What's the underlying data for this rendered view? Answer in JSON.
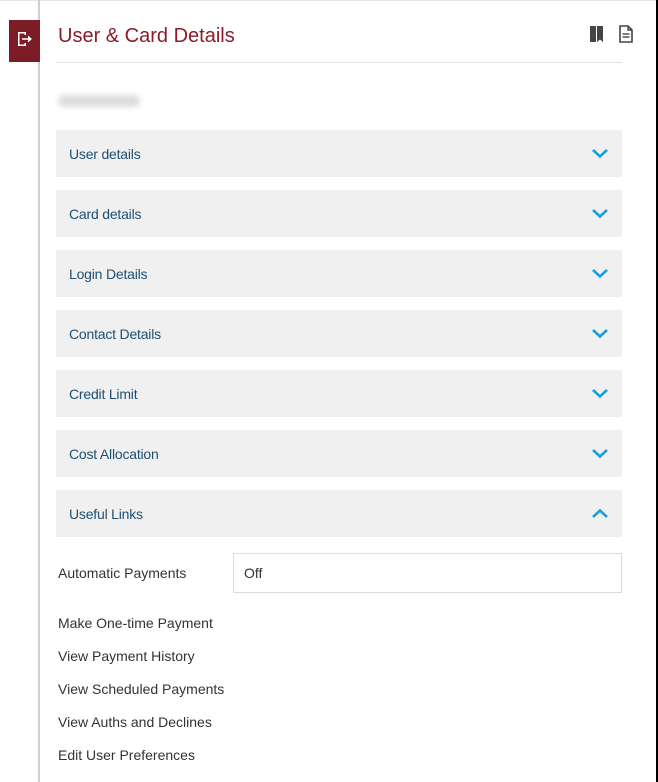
{
  "header": {
    "title": "User & Card Details",
    "exit_icon": "exit-icon",
    "icons": [
      "book-icon",
      "document-icon"
    ]
  },
  "user": {
    "name_redacted": true
  },
  "accordion": [
    {
      "label": "User details",
      "expanded": false
    },
    {
      "label": "Card details",
      "expanded": false
    },
    {
      "label": "Login Details",
      "expanded": false
    },
    {
      "label": "Contact Details",
      "expanded": false
    },
    {
      "label": "Credit Limit",
      "expanded": false
    },
    {
      "label": "Cost Allocation",
      "expanded": false
    },
    {
      "label": "Useful Links",
      "expanded": true
    }
  ],
  "useful_links": {
    "automatic_payments_label": "Automatic Payments",
    "automatic_payments_value": "Off",
    "links": [
      "Make One-time Payment",
      "View Payment History",
      "View Scheduled Payments",
      "View Auths and Declines",
      "Edit User Preferences"
    ]
  },
  "colors": {
    "brand": "#7b1c27",
    "title": "#8a1c2b",
    "accordion_label": "#1f4f73",
    "chevron": "#1aa0dd",
    "accordion_bg": "#f0f0f0"
  }
}
